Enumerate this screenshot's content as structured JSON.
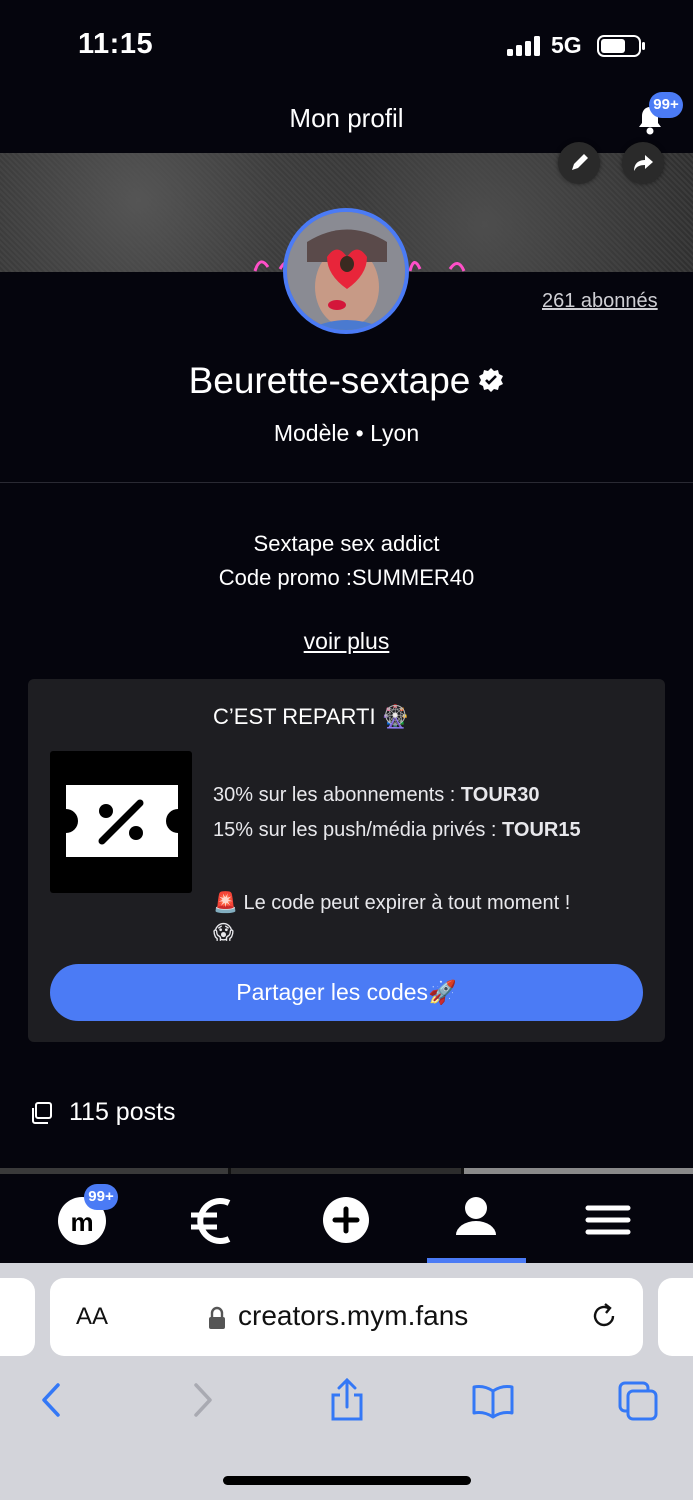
{
  "status_bar": {
    "time": "11:15",
    "network": "5G"
  },
  "header": {
    "title": "Mon profil",
    "notifications_badge": "99+"
  },
  "profile": {
    "followers": "261 abonnés",
    "name": "Beurette-sextape",
    "subtitle": "Modèle • Lyon",
    "bio_line1": "Sextape sex addict",
    "bio_line2": "Code promo :SUMMER40",
    "see_more": "voir plus"
  },
  "promo": {
    "title": "C’EST REPARTI 🎡",
    "line1_text": "30% sur les abonnements : ",
    "line1_code": "TOUR30",
    "line2_text": "15% sur les push/média privés : ",
    "line2_code": "TOUR15",
    "warning": "🚨 Le code peut expirer à tout moment !",
    "warning_emoji": "😱",
    "share_button": "Partager les codes🚀"
  },
  "posts": {
    "count_label": "115 posts"
  },
  "bottom_nav": {
    "badge": "99+",
    "items": [
      "mym-home",
      "euro",
      "add",
      "profile",
      "menu"
    ],
    "active": "profile"
  },
  "browser": {
    "aa_label": "AA",
    "url": "creators.mym.fans"
  },
  "colors": {
    "accent": "#4b7bf5",
    "background": "#05050d",
    "card": "#1e1e22"
  }
}
